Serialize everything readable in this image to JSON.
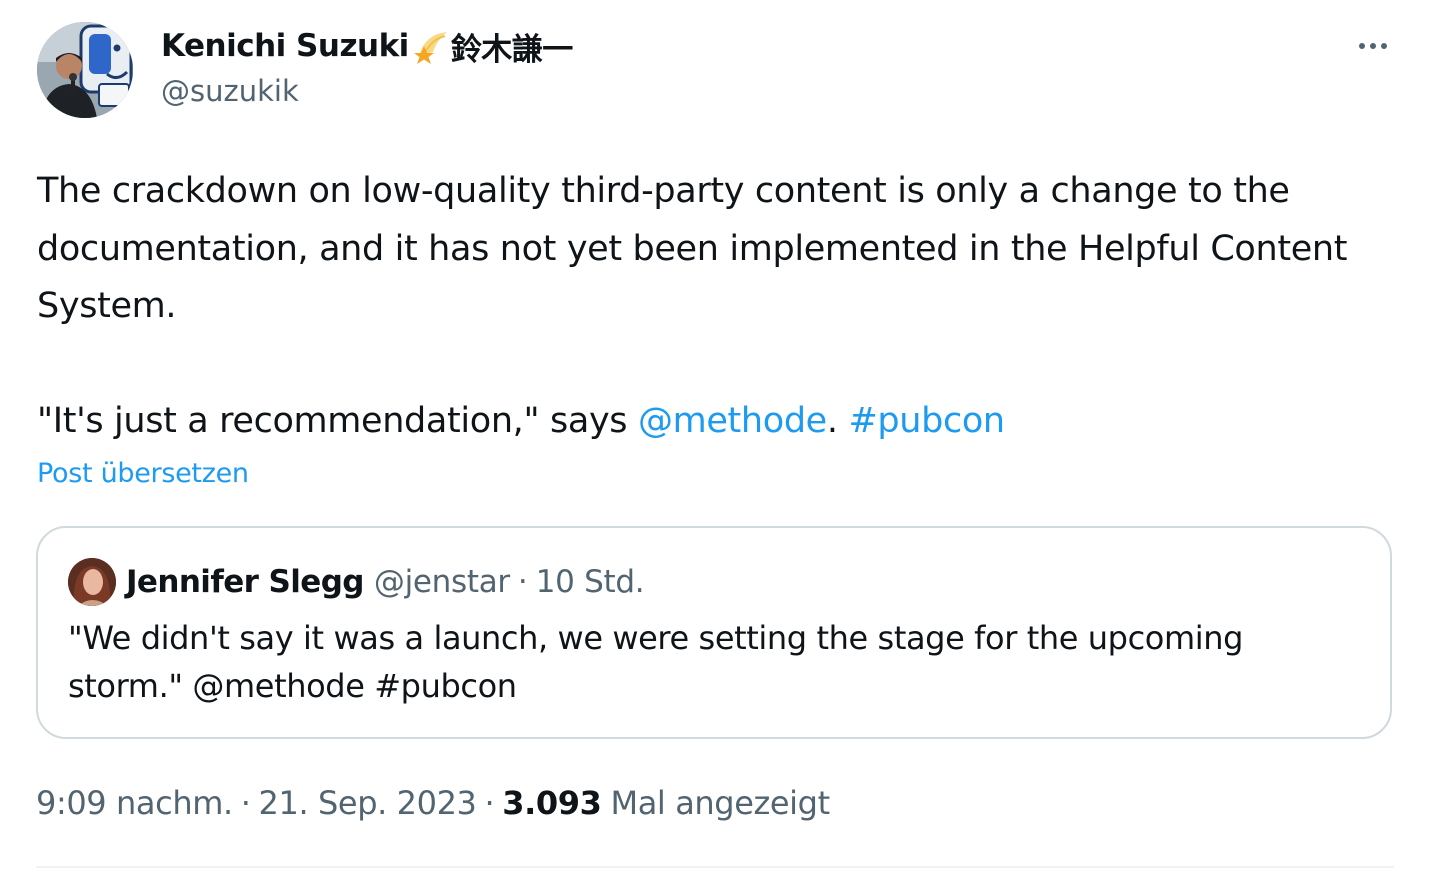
{
  "author": {
    "display_name": "Kenichi Suzuki",
    "badge_text": "鈴木謙一",
    "handle": "@suzukik"
  },
  "post": {
    "text_line1": "The crackdown on low-quality third-party content is only a change to the documentation, and it has not yet been implemented in the Helpful Content System.",
    "text_quote_prefix": "\"It's just a recommendation,\" says ",
    "mention": "@methode",
    "after_mention": ". ",
    "hashtag": "#pubcon",
    "translate_label": "Post übersetzen"
  },
  "quoted_post": {
    "display_name": "Jennifer Slegg",
    "handle": "@jenstar",
    "separator": "·",
    "time": "10 Std.",
    "text": "\"We didn't say it was a launch, we were setting the stage for the upcoming storm.\"  @methode #pubcon"
  },
  "meta": {
    "time": "9:09 nachm.",
    "separator": "·",
    "date": "21. Sep. 2023",
    "views_count": "3.093",
    "views_label": "Mal angezeigt"
  },
  "colors": {
    "link": "#1d9bf0",
    "secondary_text": "#536471",
    "primary_text": "#0f1419",
    "border": "#cfd9de"
  }
}
